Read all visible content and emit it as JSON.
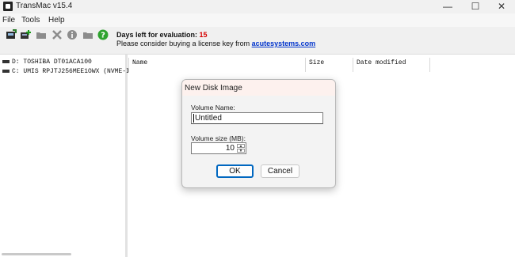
{
  "window": {
    "title": "TransMac v15.4",
    "minimize_glyph": "—",
    "maximize_glyph": "☐",
    "close_glyph": "✕"
  },
  "menu": [
    "File",
    "Tools",
    "Help"
  ],
  "toolbar": {
    "icons": [
      "open-disk-image-icon",
      "add-disk-icon",
      "folder-icon",
      "delete-icon",
      "info-icon",
      "new-folder-icon",
      "help-icon"
    ]
  },
  "evaluation": {
    "days_label": "Days left for evaluation:",
    "days_value": "15",
    "license_text": "Please consider buying a license key from",
    "license_link": "acutesystems.com"
  },
  "drives": [
    {
      "letter": "D:",
      "name": "TOSHIBA DT01ACA100"
    },
    {
      "letter": "C:",
      "name": "UMIS RPJTJ256MEE1OWX (NVME-I"
    }
  ],
  "columns": {
    "name": "Name",
    "size": "Size",
    "date": "Date modified"
  },
  "dialog": {
    "title": "New Disk Image",
    "volume_name_label": "Volume Name:",
    "volume_name_value": "Untitled",
    "volume_size_label": "Volume size (MB):",
    "volume_size_value": "10",
    "ok_label": "OK",
    "cancel_label": "Cancel"
  },
  "colors": {
    "accent": "#0067c0",
    "days_value": "#d60000",
    "link": "#0033cc"
  }
}
